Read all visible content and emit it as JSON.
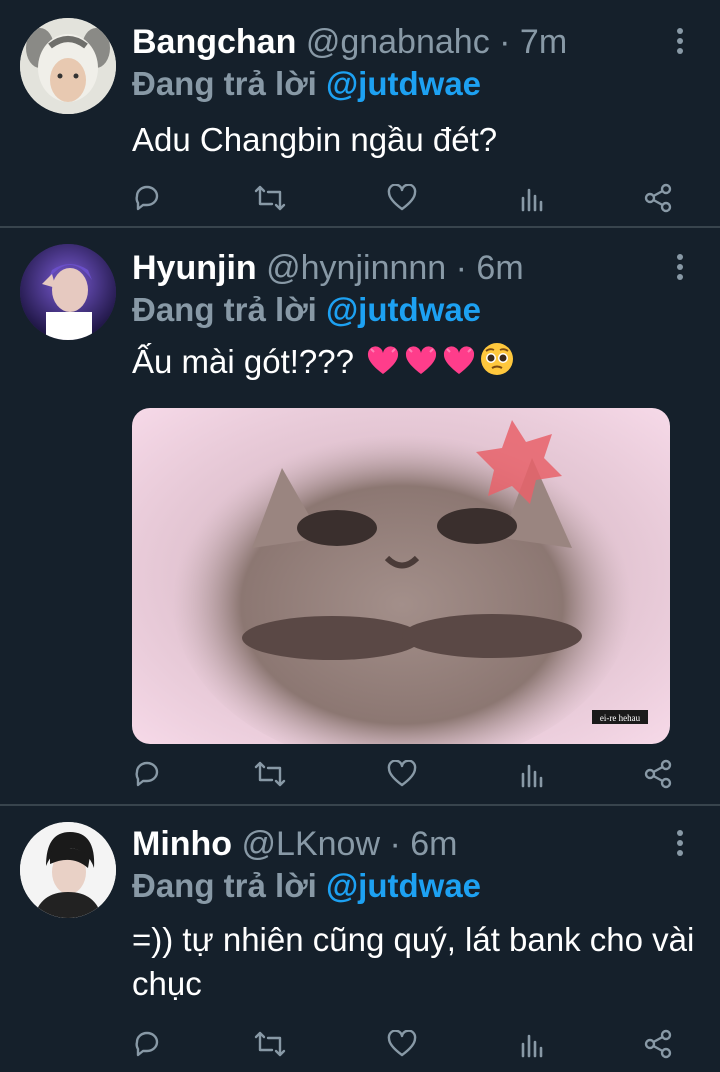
{
  "tweets": [
    {
      "name": "Bangchan",
      "handle": "@gnabnahc",
      "time": "7m",
      "reply_prefix": "Đang trả lời",
      "reply_to": "@jutdwae",
      "text": "Adu Changbin ngầu đét?"
    },
    {
      "name": "Hyunjin",
      "handle": "@hynjinnnn",
      "time": "6m",
      "reply_prefix": "Đang trả lời",
      "reply_to": "@jutdwae",
      "text": "Ấu mài gót!???",
      "media_watermark": "ei-re hehau"
    },
    {
      "name": "Minho",
      "handle": "@LKnow",
      "time": "6m",
      "reply_prefix": "Đang trả lời",
      "reply_to": "@jutdwae",
      "text": "=)) tự nhiên cũng quý, lát bank cho vài chục"
    }
  ],
  "separator": " · ",
  "colors": {
    "background": "#15202b",
    "accent": "#1da1f2",
    "muted": "#8899a6",
    "divider": "#38444d"
  },
  "icons": [
    "reply-icon",
    "retweet-icon",
    "like-icon",
    "analytics-icon",
    "share-icon",
    "more-icon"
  ]
}
